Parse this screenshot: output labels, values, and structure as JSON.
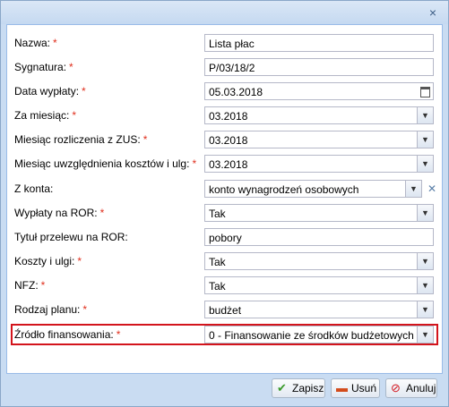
{
  "window": {
    "close_symbol": "×"
  },
  "form": {
    "rows": [
      {
        "label": "Nazwa:",
        "required": true,
        "value": "Lista płac",
        "kind": "text"
      },
      {
        "label": "Sygnatura:",
        "required": true,
        "value": "P/03/18/2",
        "kind": "text"
      },
      {
        "label": "Data wypłaty:",
        "required": true,
        "value": "05.03.2018",
        "kind": "date"
      },
      {
        "label": "Za miesiąc:",
        "required": true,
        "value": "03.2018",
        "kind": "select"
      },
      {
        "label": "Miesiąc rozliczenia z ZUS:",
        "required": true,
        "value": "03.2018",
        "kind": "select"
      },
      {
        "label": "Miesiąc uwzględnienia kosztów i ulg:",
        "required": true,
        "value": "03.2018",
        "kind": "select"
      },
      {
        "label": "Z konta:",
        "required": false,
        "value": "konto wynagrodzeń osobowych",
        "kind": "select-clear"
      },
      {
        "label": "Wypłaty na ROR:",
        "required": true,
        "value": "Tak",
        "kind": "select"
      },
      {
        "label": "Tytuł przelewu na ROR:",
        "required": false,
        "value": "pobory",
        "kind": "text"
      },
      {
        "label": "Koszty i ulgi:",
        "required": true,
        "value": "Tak",
        "kind": "select"
      },
      {
        "label": "NFZ:",
        "required": true,
        "value": "Tak",
        "kind": "select"
      },
      {
        "label": "Rodzaj planu:",
        "required": true,
        "value": "budżet",
        "kind": "select"
      },
      {
        "label": "Źródło finansowania:",
        "required": true,
        "value": "0 - Finansowanie ze środków budżetowych",
        "kind": "select"
      }
    ],
    "required_mark": "*"
  },
  "buttons": {
    "save": "Zapisz",
    "delete": "Usuń",
    "cancel": "Anuluj"
  },
  "colors": {
    "required": "#e0301e",
    "highlight_border": "#d3141c",
    "window_bg": "#c9dcf2"
  }
}
